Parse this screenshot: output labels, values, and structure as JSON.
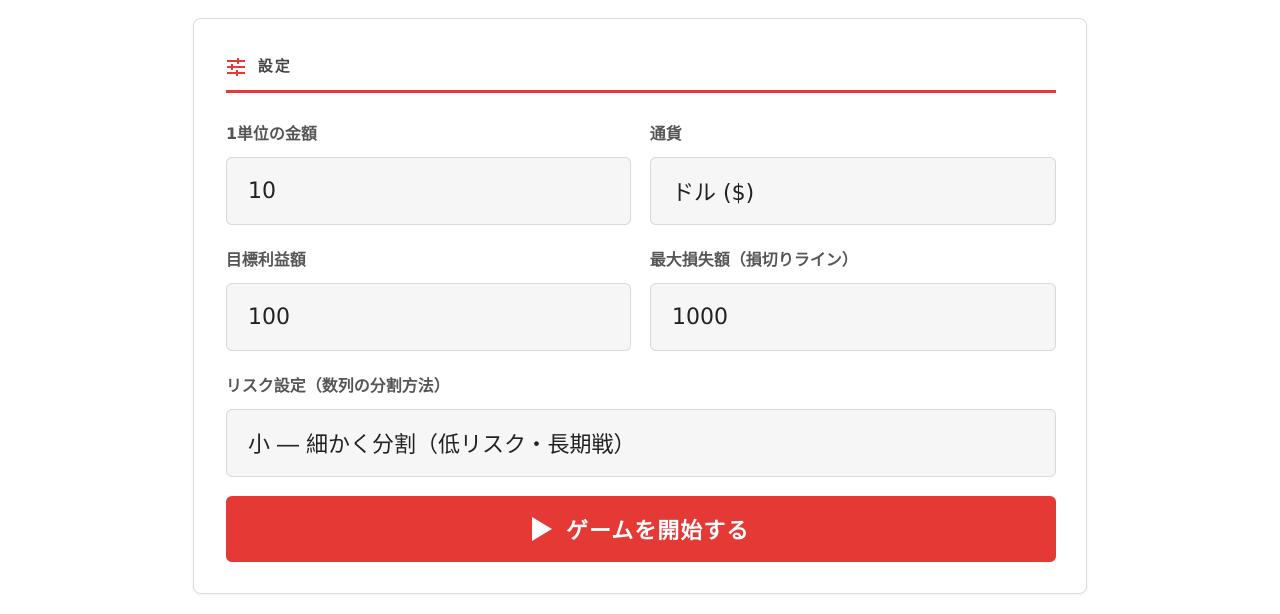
{
  "header": {
    "icon": "sliders-icon",
    "title": "設定"
  },
  "fields": {
    "unit_amount": {
      "label": "1単位の金額",
      "value": "10"
    },
    "currency": {
      "label": "通貨",
      "value": "ドル ($)"
    },
    "target_profit": {
      "label": "目標利益額",
      "value": "100"
    },
    "max_loss": {
      "label": "最大損失額（損切りライン）",
      "value": "1000"
    },
    "risk": {
      "label": "リスク設定（数列の分割方法）",
      "value": "小 ― 細かく分割（低リスク・長期戦）"
    }
  },
  "start_button": {
    "icon": "play-icon",
    "label": "ゲームを開始する"
  },
  "colors": {
    "accent": "#e53935",
    "field_bg": "#f6f6f6",
    "label_text": "#555555"
  }
}
